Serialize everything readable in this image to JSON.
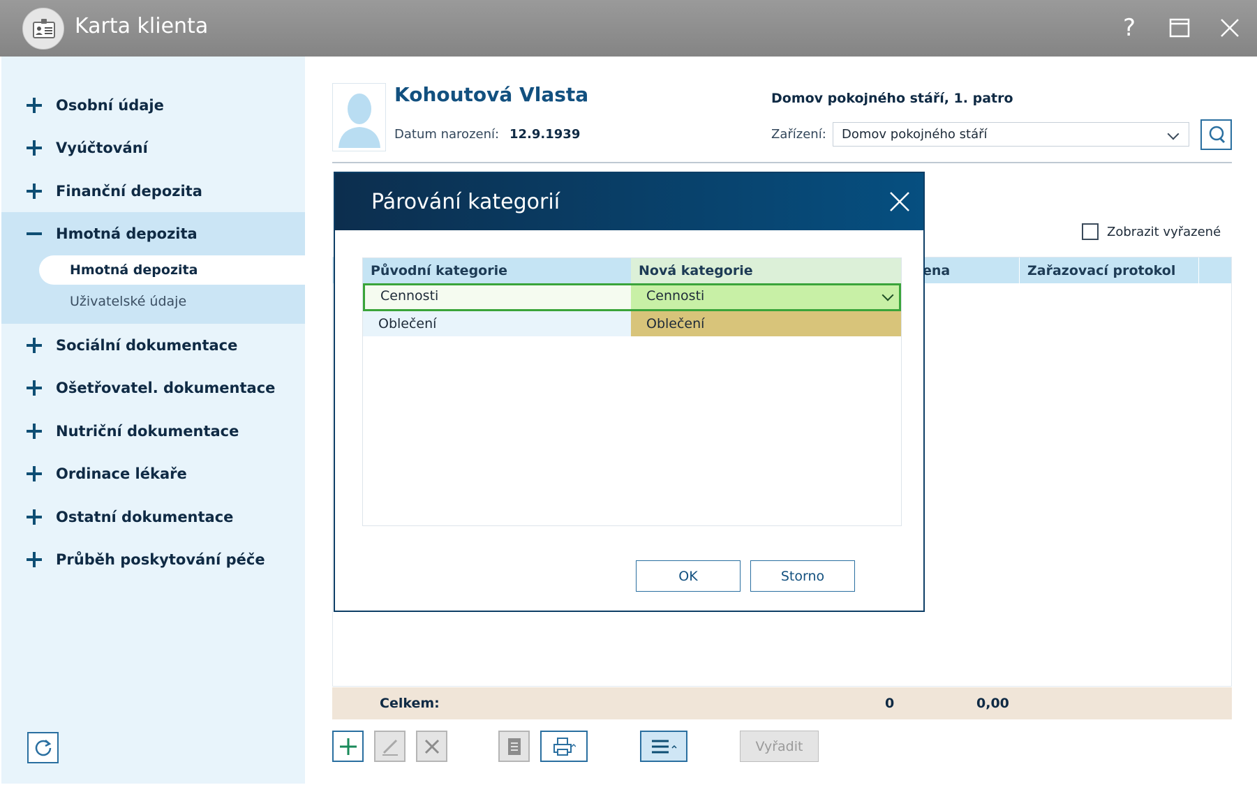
{
  "window": {
    "title": "Karta klienta",
    "help_glyph": "?",
    "maximize_glyph": "□",
    "close_glyph": "✕"
  },
  "sidebar": {
    "items": [
      {
        "label": "Osobní údaje",
        "state": "collapsed"
      },
      {
        "label": "Vyúčtování",
        "state": "collapsed"
      },
      {
        "label": "Finanční depozita",
        "state": "collapsed"
      },
      {
        "label": "Hmotná depozita",
        "state": "expanded"
      },
      {
        "label": "Sociální dokumentace",
        "state": "collapsed"
      },
      {
        "label": "Ošetřovatel. dokumentace",
        "state": "collapsed"
      },
      {
        "label": "Nutriční dokumentace",
        "state": "collapsed"
      },
      {
        "label": "Ordinace lékaře",
        "state": "collapsed"
      },
      {
        "label": "Ostatní dokumentace",
        "state": "collapsed"
      },
      {
        "label": "Průběh poskytování péče",
        "state": "collapsed"
      }
    ],
    "subitems": [
      {
        "label": "Hmotná depozita",
        "active": true
      },
      {
        "label": "Uživatelské údaje",
        "active": false
      }
    ]
  },
  "client": {
    "name": "Kohoutová Vlasta",
    "dob_label": "Datum narození:",
    "dob_value": "12.9.1939",
    "facility_title": "Domov pokojného stáří, 1. patro",
    "facility_label": "Zařízení:",
    "facility_value": "Domov pokojného stáří"
  },
  "list": {
    "show_discarded_label": "Zobrazit vyřazené",
    "show_discarded_checked": false,
    "columns_visible": [
      "ena",
      "Zařazovací protokol"
    ],
    "total_label": "Celkem:",
    "total_count": "0",
    "total_value": "0,00"
  },
  "toolbar": {
    "discard_label": "Vyřadit"
  },
  "dialog": {
    "title": "Párování kategorií",
    "col_original": "Původní kategorie",
    "col_new": "Nová kategorie",
    "rows": [
      {
        "original": "Cennosti",
        "new": "Cennosti",
        "selected": true
      },
      {
        "original": "Oblečení",
        "new": "Oblečení",
        "selected": false
      }
    ],
    "ok_label": "OK",
    "cancel_label": "Storno"
  },
  "colors": {
    "sidebar_bg": "#e8f4fb",
    "accent": "#12507f",
    "dialog_header": "#0c2e4e",
    "selected_row_border": "#3aa43a",
    "mapped_cell": "#d8c47a"
  }
}
